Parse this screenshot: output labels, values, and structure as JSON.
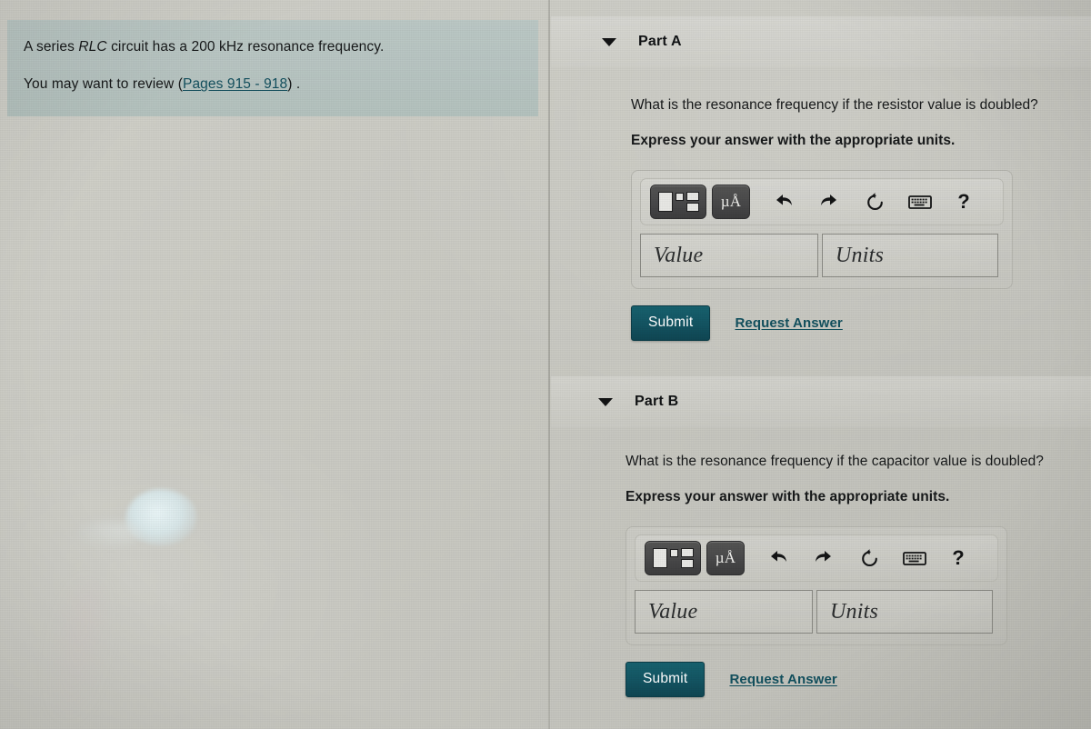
{
  "left_panel": {
    "question_statement": {
      "prefix": "A series ",
      "italic_term": "RLC",
      "suffix": " circuit has a 200 kHz resonance frequency."
    },
    "review_note": {
      "prefix": "You may want to review (",
      "link_text": "Pages 915 - 918",
      "suffix": ") ."
    }
  },
  "right_panel": {
    "parts": [
      {
        "title": "Part A",
        "caret_icon": "caret-down-icon",
        "question": "What is the resonance frequency if the resistor value is doubled?",
        "instruction": "Express your answer with the appropriate units.",
        "answer_widget": {
          "toolbar": {
            "template_button_label": "math-template",
            "units_button_label": "µÅ",
            "undo_icon": "undo-arrow-icon",
            "redo_icon": "redo-arrow-icon",
            "reset_icon": "reset-circular-arrow-icon",
            "keyboard_icon": "keyboard-icon",
            "help_label": "?"
          },
          "value_placeholder": "Value",
          "units_placeholder": "Units",
          "value_current": "",
          "units_current": ""
        },
        "submit_label": "Submit",
        "request_answer_label": "Request Answer"
      },
      {
        "title": "Part B",
        "caret_icon": "caret-down-icon",
        "question": "What is the resonance frequency if the capacitor value is doubled?",
        "instruction": "Express your answer with the appropriate units.",
        "answer_widget": {
          "toolbar": {
            "template_button_label": "math-template",
            "units_button_label": "µÅ",
            "undo_icon": "undo-arrow-icon",
            "redo_icon": "redo-arrow-icon",
            "reset_icon": "reset-circular-arrow-icon",
            "keyboard_icon": "keyboard-icon",
            "help_label": "?"
          },
          "value_placeholder": "Value",
          "units_placeholder": "Units",
          "value_current": "",
          "units_current": ""
        },
        "submit_label": "Submit",
        "request_answer_label": "Request Answer"
      }
    ]
  },
  "colors": {
    "question_box_bg": "#b9c6c3",
    "page_bg": "#c9c9c2",
    "link_teal": "#13505e",
    "submit_teal": "#135462",
    "toolbar_dark_button": "#49494a",
    "text_dark": "#17191a"
  }
}
